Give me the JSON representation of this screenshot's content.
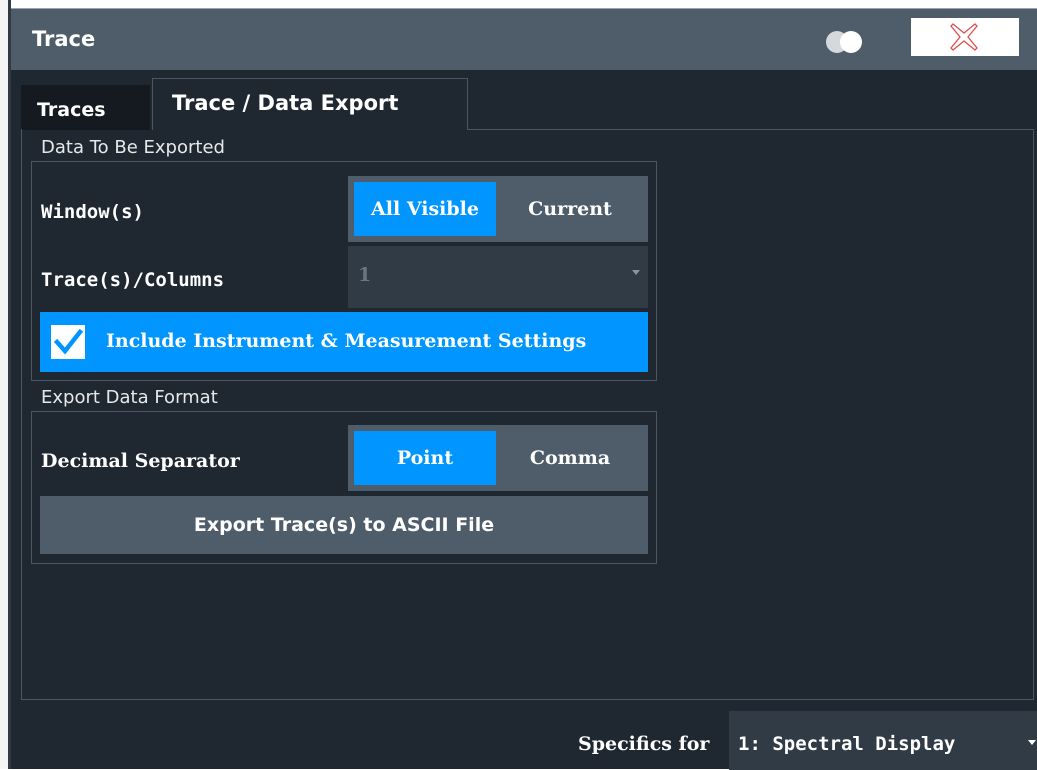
{
  "dialog": {
    "title": "Trace",
    "toggle_icon": "toggle-icon",
    "close_icon": "close-x-icon",
    "accent_color": "#0095ff"
  },
  "tabs": [
    {
      "label": "Traces",
      "active": false
    },
    {
      "label": "Trace / Data Export",
      "active": true
    }
  ],
  "data_to_export": {
    "group_label": "Data To Be Exported",
    "windows": {
      "label": "Window(s)",
      "options": [
        "All Visible",
        "Current"
      ],
      "selected": "All Visible"
    },
    "traces": {
      "label": "Trace(s)/Columns",
      "value": "1",
      "disabled": true
    },
    "include_settings": {
      "label": "Include Instrument & Measurement Settings",
      "checked": true
    }
  },
  "export_format": {
    "group_label": "Export Data Format",
    "decimal_separator": {
      "label": "Decimal Separator",
      "options": [
        "Point",
        "Comma"
      ],
      "selected": "Point"
    },
    "export_button": "Export Trace(s) to ASCII File"
  },
  "footer": {
    "specifics_label": "Specifics for",
    "specifics_value": "1: Spectral Display"
  }
}
